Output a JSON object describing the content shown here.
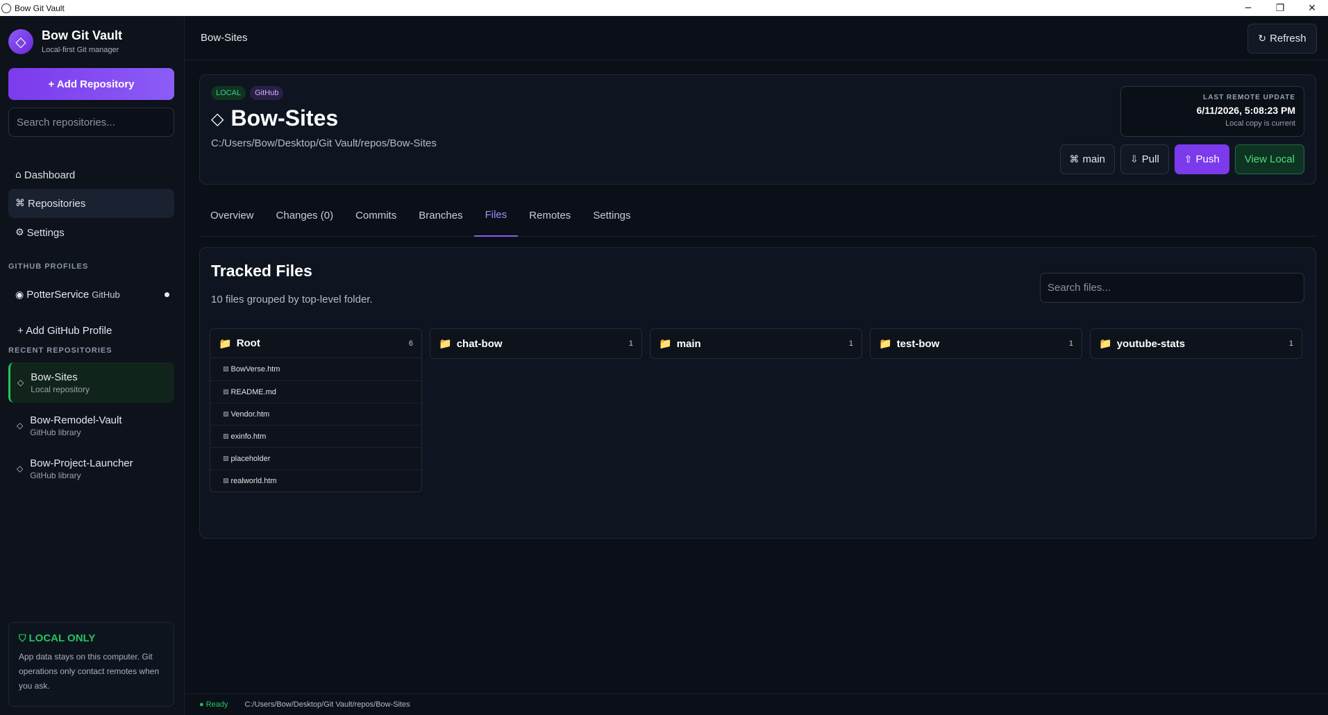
{
  "window": {
    "title": "Bow Git Vault",
    "controls": [
      "─",
      "❐",
      "✕"
    ]
  },
  "brand": {
    "logo": "◇",
    "title": "Bow Git Vault",
    "subtitle": "Local-first Git manager"
  },
  "sidebar": {
    "add_repo_label": "+ Add Repository",
    "search_placeholder": "Search repositories...",
    "nav": [
      {
        "icon": "⌂",
        "label": "Dashboard"
      },
      {
        "icon": "⌘",
        "label": "Repositories"
      },
      {
        "icon": "⚙",
        "label": "Settings"
      }
    ],
    "profiles_heading": "GITHUB PROFILES",
    "profile": {
      "icon": "◉",
      "name": "PotterService",
      "provider": "GitHub"
    },
    "add_profile_label": "+ Add GitHub Profile",
    "recent_heading": "RECENT REPOSITORIES",
    "recent": [
      {
        "icon": "◇",
        "name": "Bow-Sites",
        "sub": "Local repository"
      },
      {
        "icon": "◇",
        "name": "Bow-Remodel-Vault",
        "sub": "GitHub library"
      },
      {
        "icon": "◇",
        "name": "Bow-Project-Launcher",
        "sub": "GitHub library"
      }
    ],
    "local_card": {
      "icon": "⛉",
      "title": "LOCAL ONLY",
      "desc": "App data stays on this computer. Git operations only contact remotes when you ask."
    }
  },
  "header": {
    "breadcrumb": "Bow-Sites",
    "refresh_icon": "↻",
    "refresh_label": "Refresh"
  },
  "repo": {
    "badges": [
      "LOCAL",
      "GitHub"
    ],
    "icon": "◇",
    "name": "Bow-Sites",
    "path": "C:/Users/Bow/Desktop/Git Vault/repos/Bow-Sites",
    "remote": {
      "label": "LAST REMOTE UPDATE",
      "value": "6/11/2026, 5:08:23 PM",
      "sub": "Local copy is current"
    },
    "actions": {
      "branch_icon": "⌘",
      "branch_label": "main",
      "pull_icon": "⇩",
      "pull_label": "Pull",
      "push_icon": "⇧",
      "push_label": "Push",
      "view_label": "View Local"
    }
  },
  "tabs": [
    "Overview",
    "Changes (0)",
    "Commits",
    "Branches",
    "Files",
    "Remotes",
    "Settings"
  ],
  "active_tab": "Files",
  "files": {
    "title": "Tracked Files",
    "subtitle": "10 files grouped by top-level folder.",
    "search_placeholder": "Search files...",
    "folder_icon": "📁",
    "file_icon": "▧",
    "folders": [
      {
        "name": "Root",
        "count": "6",
        "files": [
          "BowVerse.htm",
          "README.md",
          "Vendor.htm",
          "exinfo.htm",
          "placeholder",
          "realworld.htm"
        ]
      },
      {
        "name": "chat-bow",
        "count": "1",
        "files": []
      },
      {
        "name": "main",
        "count": "1",
        "files": []
      },
      {
        "name": "test-bow",
        "count": "1",
        "files": []
      },
      {
        "name": "youtube-stats",
        "count": "1",
        "files": []
      }
    ]
  },
  "status": {
    "ready": "● Ready",
    "path": "C:/Users/Bow/Desktop/Git Vault/repos/Bow-Sites"
  },
  "colors": {
    "accent": "#8b5cf6",
    "success": "#22c55e",
    "background": "#0b0f17"
  }
}
